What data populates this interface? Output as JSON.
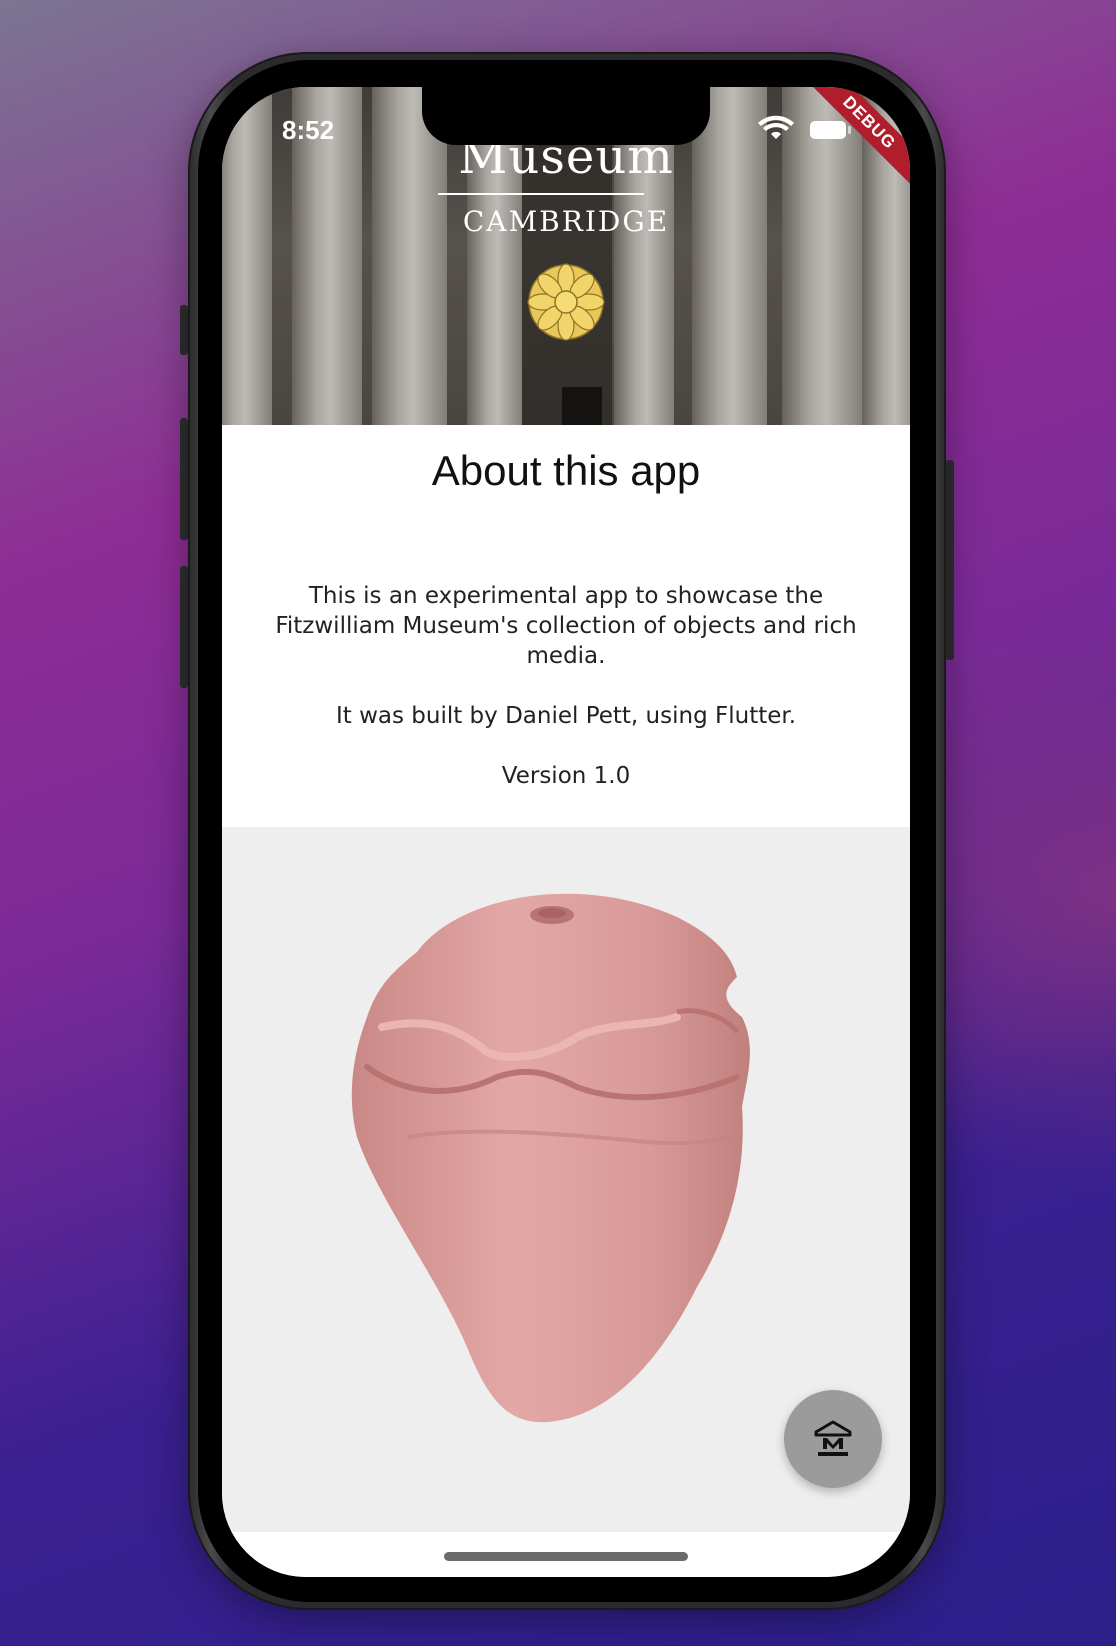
{
  "status_bar": {
    "time": "8:52",
    "debug_label": "DEBUG"
  },
  "header": {
    "title": "Museum",
    "subtitle": "CAMBRIDGE"
  },
  "about": {
    "title": "About this app",
    "description": "This is an experimental app to showcase the Fitzwilliam Museum's collection of objects and rich media.",
    "credit": "It was built by Daniel Pett, using Flutter.",
    "version": "Version 1.0"
  },
  "viewer": {
    "model_color": "#d89a98",
    "background": "#eeeeee"
  },
  "fab": {
    "icon": "museum-icon",
    "color": "#9b9b9b"
  },
  "icons": {
    "emblem": "flower-emblem-icon",
    "wifi": "wifi-icon",
    "battery": "battery-icon"
  },
  "colors": {
    "emblem_gold": "#e9c75a",
    "debug_red": "#b01d2b"
  }
}
